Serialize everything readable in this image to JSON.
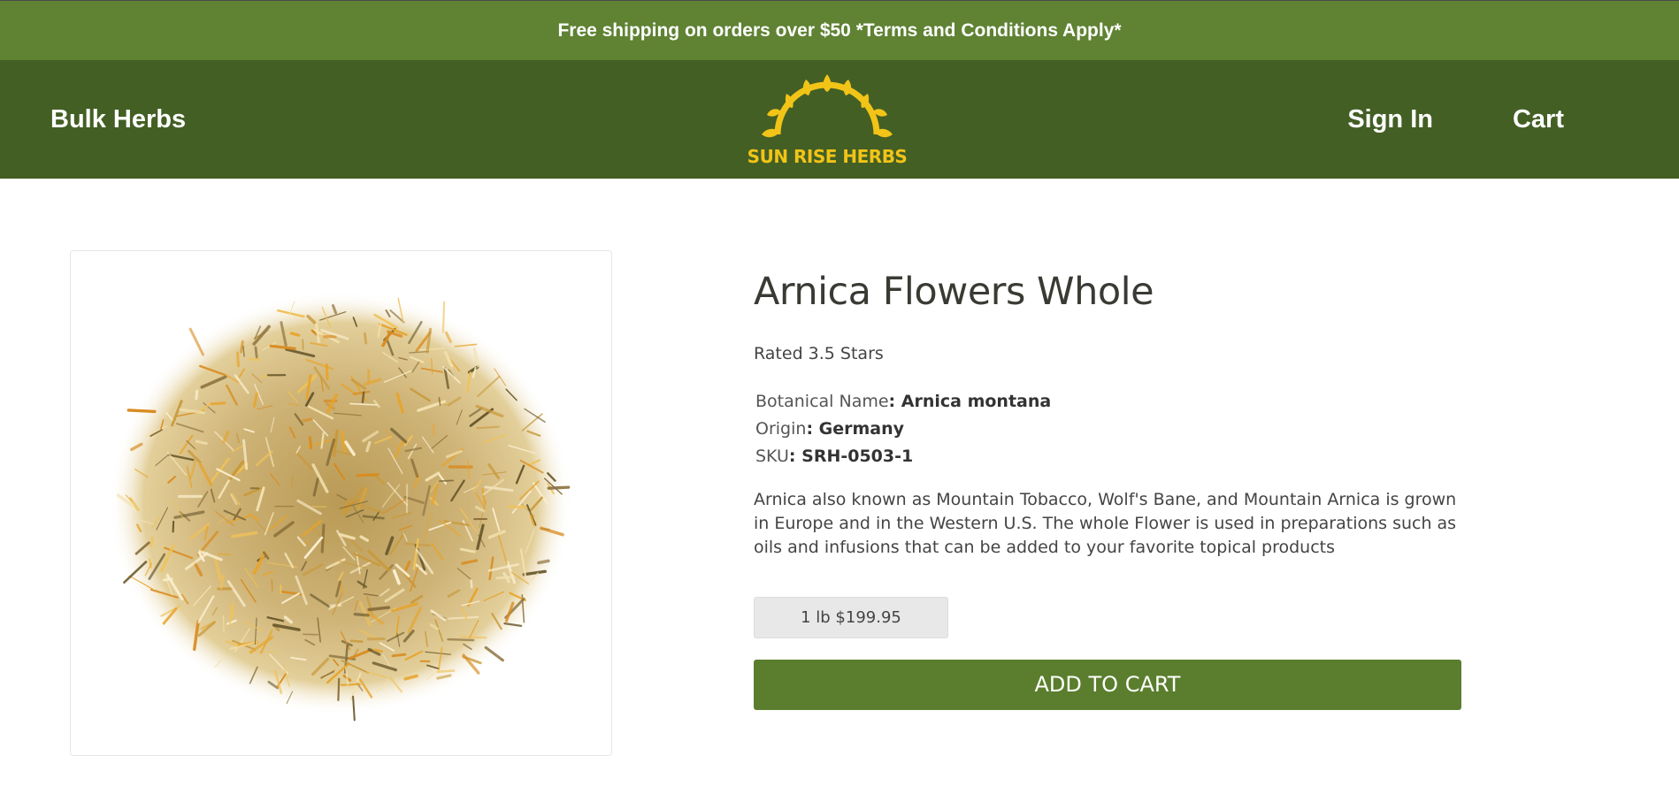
{
  "promo_banner": {
    "text": "Free shipping on orders over $50 *Terms and Conditions Apply*"
  },
  "header": {
    "nav_left": "Bulk Herbs",
    "logo_text": "SUN RISE HERBS",
    "sign_in": "Sign In",
    "cart": "Cart"
  },
  "product": {
    "title": "Arnica Flowers Whole",
    "rating_text": "Rated 3.5 Stars",
    "rating": 3.5,
    "specs": [
      {
        "label": "Botanical Name",
        "value": ": Arnica montana"
      },
      {
        "label": "Origin",
        "value": ": Germany"
      },
      {
        "label": "SKU",
        "value": ": SRH-0503-1"
      }
    ],
    "description": "Arnica also known as Mountain Tobacco, Wolf's Bane, and Mountain Arnica is grown in Europe and in the Western U.S. The whole Flower is used in preparations such as oils and infusions that can be added to your favorite topical products",
    "variant": "1 lb $199.95",
    "add_to_cart": "ADD TO CART"
  },
  "colors": {
    "promo_green": "#5f8233",
    "header_green": "#435f24",
    "button_green": "#5a7e2d",
    "logo_yellow": "#f2c417"
  },
  "icons": {
    "logo": "sunrise-logo-icon",
    "product_image": "dried-arnica-flowers-image"
  }
}
